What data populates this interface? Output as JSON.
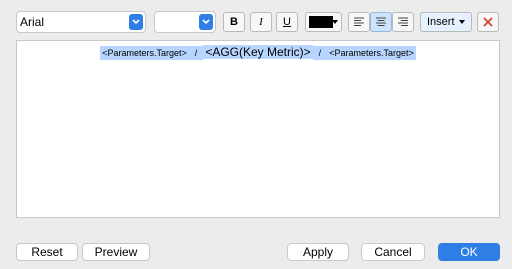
{
  "toolbar": {
    "font_value": "Arial",
    "size_value": "",
    "bold_label": "B",
    "italic_label": "I",
    "underline_label": "U",
    "text_color": "#000000",
    "insert_label": "Insert",
    "icons": {
      "dropdown": "chevron-down-icon",
      "align_left": "align-left-icon",
      "align_center": "align-center-icon",
      "align_right": "align-right-icon",
      "delete": "close-icon"
    }
  },
  "editor": {
    "text_left": "<Parameters.Target>",
    "sep1": "/",
    "text_mid": "<AGG(Key Metric)>",
    "sep2": "/",
    "text_right": "<Parameters.Target>"
  },
  "buttons": {
    "reset": "Reset",
    "preview": "Preview",
    "apply": "Apply",
    "cancel": "Cancel",
    "ok": "OK"
  },
  "colors": {
    "accent": "#2f7ee6",
    "selection": "#b8d5ff",
    "delete_icon": "#d53b2e"
  }
}
